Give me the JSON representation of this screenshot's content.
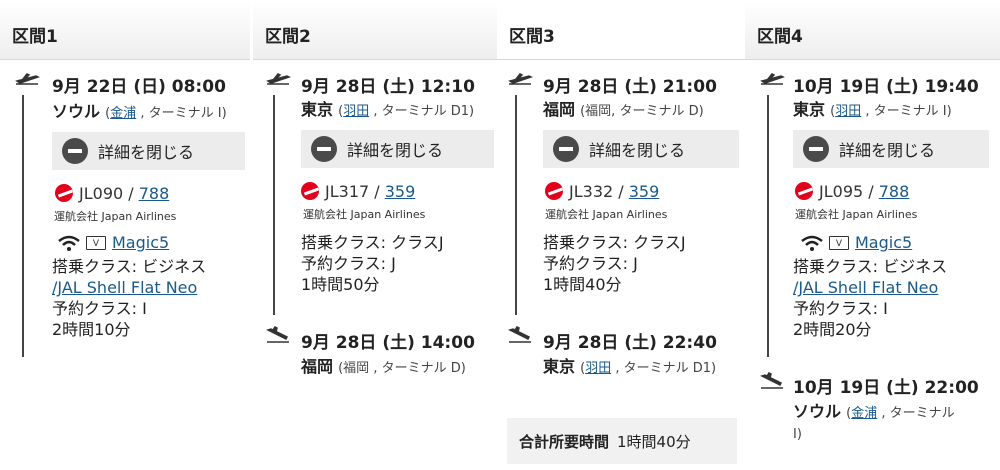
{
  "segments": [
    {
      "title": "区間1",
      "dep": {
        "datetime": "9月 22日 (日) 08:00",
        "city": "ソウル",
        "airport_link": "金浦",
        "terminal": "ターミナル I)"
      },
      "close_label": "詳細を閉じる",
      "flight": {
        "number": "JL090",
        "aircraft": "788",
        "operator": "運航会社 Japan Airlines"
      },
      "amenity": {
        "entertainment": "Magic5",
        "wifi": true,
        "tv_label": "V"
      },
      "class": "搭乗クラス: ビジネス",
      "seat": "/JAL Shell Flat Neo",
      "booking": "予約クラス: I",
      "duration": "2時間10分"
    },
    {
      "title": "区間2",
      "dep": {
        "datetime": "9月 28日 (土) 12:10",
        "city": "東京",
        "airport_link": "羽田",
        "terminal": "ターミナル  D1)"
      },
      "close_label": "詳細を閉じる",
      "flight": {
        "number": "JL317",
        "aircraft": "359",
        "operator": "運航会社 Japan Airlines"
      },
      "class": "搭乗クラス: クラスJ",
      "booking": "予約クラス: J",
      "duration": "1時間50分",
      "arr": {
        "datetime": "9月 28日 (土) 14:00",
        "city": "福岡",
        "airport_plain": "(福岡 , ターミナル  D)"
      }
    },
    {
      "title": "区間3",
      "dep": {
        "datetime": "9月 28日 (土) 21:00",
        "city": "福岡",
        "airport_plain": "(福岡, ターミナル  D)"
      },
      "close_label": "詳細を閉じる",
      "flight": {
        "number": "JL332",
        "aircraft": "359",
        "operator": "運航会社 Japan Airlines"
      },
      "class": "搭乗クラス: クラスJ",
      "booking": "予約クラス: J",
      "duration": "1時間40分",
      "arr": {
        "datetime": "9月 28日 (土) 22:40",
        "city": "東京",
        "airport_link": "羽田",
        "terminal": "ターミナル  D1)"
      },
      "total_label": "合計所要時間",
      "total_value": "1時間40分"
    },
    {
      "title": "区間4",
      "dep": {
        "datetime": "10月 19日 (土) 19:40",
        "city": "東京",
        "airport_link": "羽田",
        "terminal": "ターミナル  I)"
      },
      "close_label": "詳細を閉じる",
      "flight": {
        "number": "JL095",
        "aircraft": "788",
        "operator": "運航会社 Japan Airlines"
      },
      "amenity": {
        "entertainment": "Magic5",
        "wifi": true,
        "tv_label": "V"
      },
      "class": "搭乗クラス: ビジネス",
      "seat": "/JAL Shell Flat Neo",
      "booking": "予約クラス: I",
      "duration": "2時間20分",
      "arr": {
        "datetime": "10月 19日 (土) 22:00",
        "city": "ソウル",
        "airport_link": "金浦",
        "terminal": "ターミナル"
      },
      "arr_terminal_tail": "I)"
    }
  ]
}
